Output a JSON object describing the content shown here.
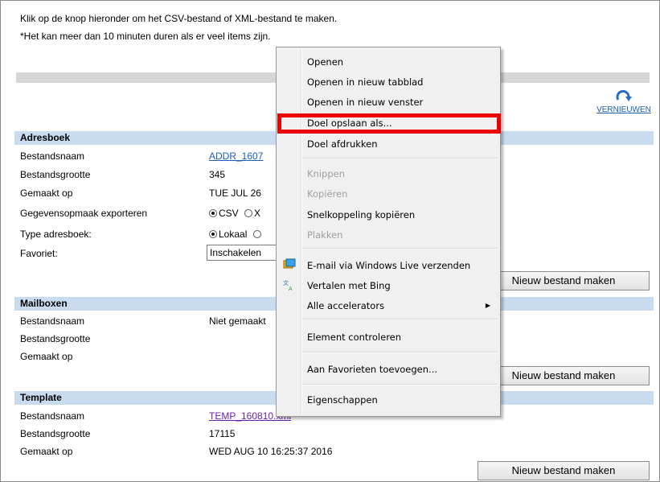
{
  "intro": {
    "line1": "Klik op de knop hieronder om het CSV-bestand of XML-bestand te maken.",
    "line2": "*Het kan meer dan 10 minuten duren als er veel items zijn."
  },
  "refresh": {
    "label": "VERNIEUWEN",
    "icon": "refresh-icon"
  },
  "addressbook": {
    "title": "Adresboek",
    "filename_label": "Bestandsnaam",
    "filename_value": "ADDR_1607",
    "size_label": "Bestandsgrootte",
    "size_value": "345",
    "created_label": "Gemaakt op",
    "created_value": "TUE JUL 26",
    "format_label": "Gegevensopmaak exporteren",
    "format_csv": "CSV",
    "format_xml": "X",
    "type_label": "Type adresboek:",
    "type_local": "Lokaal",
    "favorite_label": "Favoriet:",
    "favorite_value": "Inschakelen",
    "button": "Nieuw bestand maken"
  },
  "mailboxes": {
    "title": "Mailboxen",
    "filename_label": "Bestandsnaam",
    "filename_value": "Niet gemaakt",
    "size_label": "Bestandsgrootte",
    "created_label": "Gemaakt op",
    "button": "Nieuw bestand maken"
  },
  "template": {
    "title": "Template",
    "filename_label": "Bestandsnaam",
    "filename_value": "TEMP_160810.xml",
    "size_label": "Bestandsgrootte",
    "size_value": "17115",
    "created_label": "Gemaakt op",
    "created_value": "WED AUG 10 16:25:37 2016",
    "button": "Nieuw bestand maken"
  },
  "context_menu": {
    "open": "Openen",
    "open_tab": "Openen in nieuw tabblad",
    "open_window": "Openen in nieuw venster",
    "save_target": "Doel opslaan als...",
    "print_target": "Doel afdrukken",
    "cut": "Knippen",
    "copy": "Kopiëren",
    "copy_shortcut": "Snelkoppeling kopiëren",
    "paste": "Plakken",
    "email_live": "E-mail via Windows Live verzenden",
    "translate_bing": "Vertalen met Bing",
    "accelerators": "Alle accelerators",
    "inspect": "Element controleren",
    "add_favorites": "Aan Favorieten toevoegen...",
    "properties": "Eigenschappen"
  },
  "colors": {
    "section_header": "#c9dcef",
    "link": "#1a5fb4",
    "visited_link": "#6c1fa8",
    "highlight_box": "#ef0000"
  }
}
